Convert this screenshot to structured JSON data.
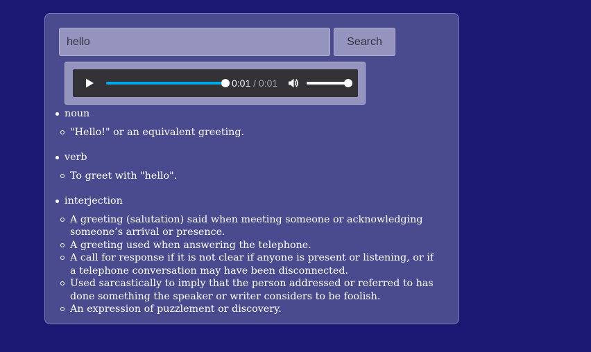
{
  "search": {
    "value": "hello",
    "button_label": "Search"
  },
  "audio": {
    "current_time": "0:01",
    "separator": " / ",
    "duration": "0:01",
    "progress": 1.0,
    "volume": 1.0,
    "play_icon": "play-icon",
    "volume_icon": "volume-icon"
  },
  "meanings": [
    {
      "part_of_speech": "noun",
      "definitions": [
        "\"Hello!\" or an equivalent greeting."
      ]
    },
    {
      "part_of_speech": "verb",
      "definitions": [
        "To greet with \"hello\"."
      ]
    },
    {
      "part_of_speech": "interjection",
      "definitions": [
        "A greeting (salutation) said when meeting someone or acknowledging someone’s arrival or presence.",
        "A greeting used when answering the telephone.",
        "A call for response if it is not clear if anyone is present or listening, or if a telephone conversation may have been disconnected.",
        "Used sarcastically to imply that the person addressed or referred to has done something the speaker or writer considers to be foolish.",
        "An expression of puzzlement or discovery."
      ]
    }
  ],
  "colors": {
    "page_background": "#1a1872",
    "card_background": "#4a4a8e",
    "progress_fill": "#00a7e6"
  }
}
